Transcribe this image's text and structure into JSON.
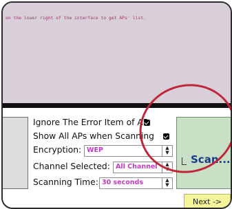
{
  "log": {
    "text": "on the lower right of the interface to get APs' list."
  },
  "options": {
    "ignore_error_label": "Ignore The Error Item of AP",
    "ignore_error_checked": true,
    "show_all_label": "Show All APs when Scanning",
    "show_all_checked": true,
    "encryption_label": "Encryption:",
    "encryption_value": "WEP",
    "channel_label": "Channel Selected:",
    "channel_value": "All Channel",
    "scan_time_label": "Scanning Time:",
    "scan_time_value": "30 seconds"
  },
  "buttons": {
    "scan_label": "Scan...",
    "next_label": "Next ->"
  },
  "colors": {
    "log_bg": "#d9cfd9",
    "scan_bg": "#c9dfc6",
    "next_bg": "#f4f59a",
    "highlight_circle": "#c0263a",
    "select_text": "#c03cc0"
  }
}
